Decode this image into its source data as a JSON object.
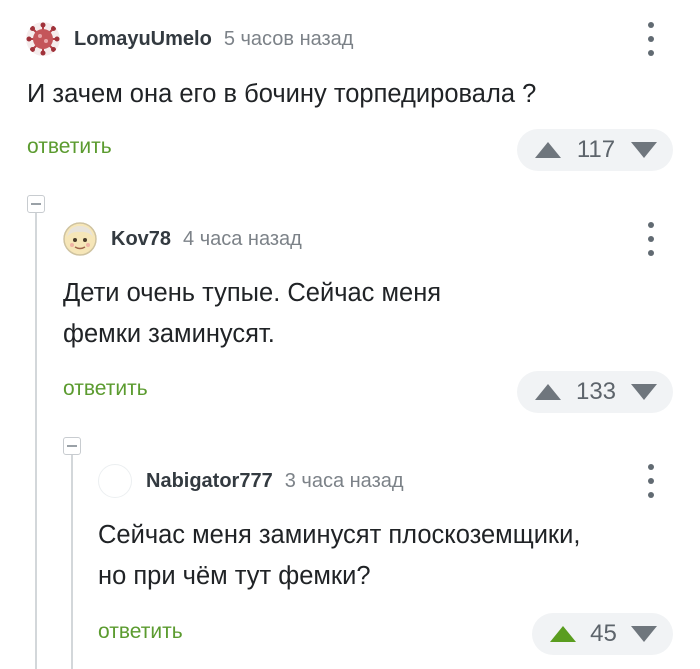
{
  "comments": [
    {
      "author": "LomayuUmelo",
      "time": "5 часов назад",
      "text": "И зачем она его в бочину торпедировала ?",
      "reply_label": "ответить",
      "rating": "117",
      "avatar": "virus-avatar"
    },
    {
      "author": "Kov78",
      "time": "4 часа назад",
      "text": "Дети очень тупые. Сейчас меня\nфемки заминусят.",
      "reply_label": "ответить",
      "rating": "133",
      "avatar": "cartoon-face-avatar"
    },
    {
      "author": "Nabigator777",
      "time": "3 часа назад",
      "text": "Сейчас меня заминусят плоскоземщики,\nно при чём тут фемки?",
      "reply_label": "ответить",
      "rating": "45",
      "avatar": "empty-avatar",
      "upvoted": true
    }
  ],
  "colors": {
    "reply_green": "#5b9b2f",
    "upvote_active": "#5a9d1f",
    "rating_bg": "#f1f3f5"
  }
}
